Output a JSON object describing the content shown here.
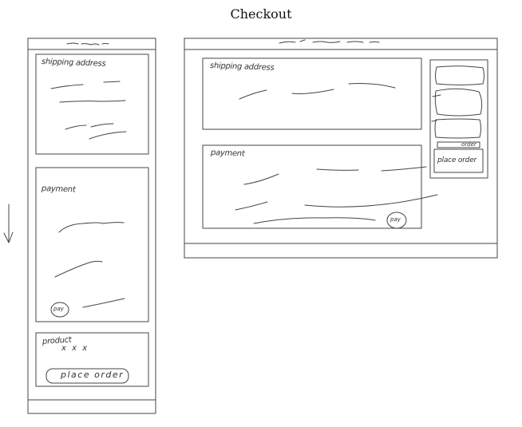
{
  "title": "Checkout",
  "mobile": {
    "shipping_label": "shipping address",
    "payment_label": "payment",
    "pay_button": "pay",
    "product_label": "product",
    "product_items": "x x x",
    "place_order_button": "place order",
    "scroll_hint_icon": "arrow-down-icon"
  },
  "desktop": {
    "shipping_label": "shipping address",
    "payment_label": "payment",
    "pay_button": "pay",
    "place_order_button": "place order",
    "small_button": "order"
  }
}
